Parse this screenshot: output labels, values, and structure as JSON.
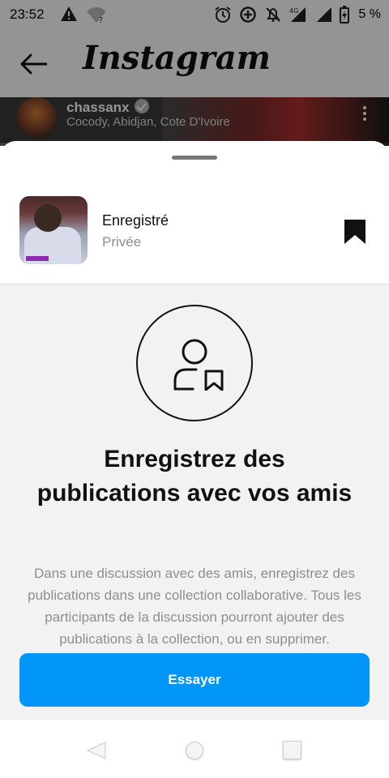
{
  "status_bar": {
    "time": "23:52",
    "battery_percent": "5 %",
    "network": "4G",
    "icons": [
      "warning-icon",
      "wifi-question-icon",
      "alarm-icon",
      "data-saver-icon",
      "mute-icon",
      "signal-icon",
      "signal-icon",
      "battery-charging-icon"
    ]
  },
  "app_bar": {
    "title": "Instagram",
    "back_icon": "back-arrow-icon"
  },
  "post_header": {
    "username": "chassanx",
    "location": "Cocody, Abidjan, Cote D'Ivoire",
    "verified_icon": "verified-badge-icon",
    "more_icon": "more-vertical-icon"
  },
  "sheet": {
    "collection_name": "Enregistré",
    "collection_privacy": "Privée",
    "bookmark_icon": "bookmark-filled-icon",
    "illustration_icon": "person-bookmark-icon",
    "heading": "Enregistrez des publications avec vos amis",
    "description": "Dans une discussion avec des amis, enregistrez des publications dans une collection collaborative. Tous les participants de la discussion pourront ajouter des publications à la collection, ou en supprimer.",
    "button_label": "Essayer"
  },
  "nav_bar": {
    "icons": [
      "nav-back-icon",
      "nav-home-icon",
      "nav-recents-icon"
    ]
  },
  "colors": {
    "primary_button": "#0095f6",
    "secondary_text": "#8e8e8e",
    "sheet_background": "#f2f2f2"
  }
}
